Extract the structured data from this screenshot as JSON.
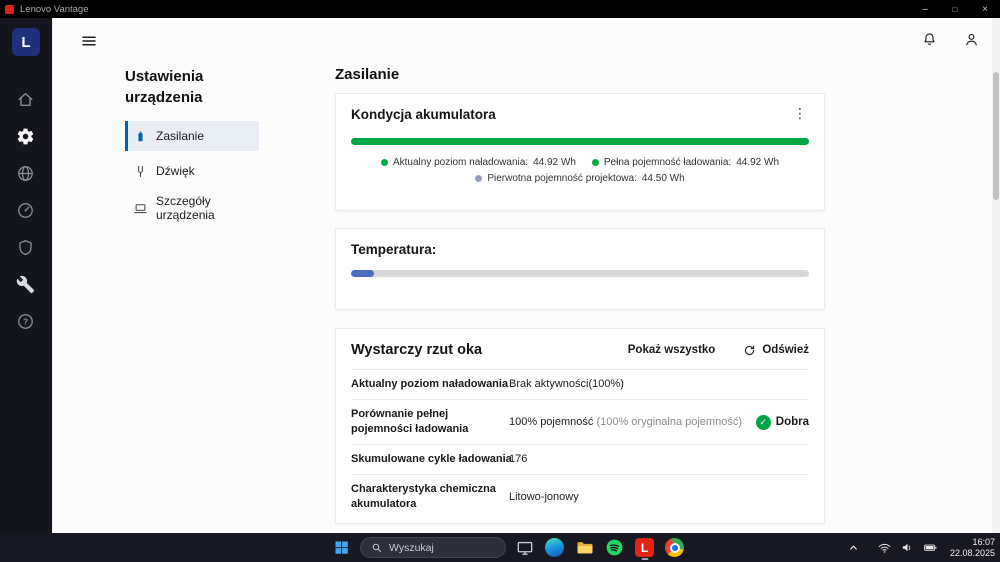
{
  "titlebar": {
    "title": "Lenovo Vantage",
    "minimize_glyph": "–",
    "maximize_glyph": "□",
    "close_glyph": "×"
  },
  "colors": {
    "accent": "#0063b1"
  },
  "sidebar": {
    "logo_letter": "L",
    "items": [
      {
        "icon": "home-icon",
        "active": false
      },
      {
        "icon": "settings-gear-icon",
        "active": true
      },
      {
        "icon": "browser-globe-icon",
        "active": false
      },
      {
        "icon": "performance-gauge-icon",
        "active": false
      },
      {
        "icon": "security-shield-icon",
        "active": false
      },
      {
        "icon": "hardware-tools-icon",
        "active": false
      },
      {
        "icon": "support-help-icon",
        "active": false
      }
    ]
  },
  "topbar": {
    "icons": [
      "notifications-bell-icon",
      "user-account-icon"
    ]
  },
  "subnav": {
    "title": "Ustawienia urządzenia",
    "items": [
      {
        "label": "Zasilanie",
        "icon": "battery-icon",
        "active": true
      },
      {
        "label": "Dźwięk",
        "icon": "sound-tuning-fork-icon",
        "active": false
      },
      {
        "label": "Szczegóły urządzenia",
        "icon": "laptop-icon",
        "active": false
      }
    ]
  },
  "main": {
    "page_title": "Zasilanie",
    "battery_card": {
      "title": "Kondycja akumulatora",
      "menu_glyph": "⋮",
      "bar_percent": 100,
      "bar_color": "#00a843",
      "legend": [
        {
          "label": "Aktualny poziom naładowania:",
          "value": "44.92 Wh",
          "color": "#00a843"
        },
        {
          "label": "Pełna pojemność ładowania:",
          "value": "44.92 Wh",
          "color": "#00c select"
        },
        {
          "label": "Pierwotna pojemność projektowa:",
          "value": "44.50 Wh",
          "color": "#94a0b8"
        }
      ]
    },
    "temperature_card": {
      "title": "Temperatura:",
      "bar_percent": 5,
      "bar_color": "#4a6cc3",
      "track_color": "#d8d8d8"
    },
    "glance_card": {
      "title": "Wystarczy rzut oka",
      "show_all_label": "Pokaż wszystko",
      "refresh_label": "Odśwież",
      "rows": [
        {
          "label": "Aktualny poziom naładowania",
          "value": "Brak aktywności(100%)"
        },
        {
          "label": "Porównanie pełnej pojemności ładowania",
          "value": "100% pojemność ",
          "value_muted": "(100% oryginalna pojemność)",
          "badge": "Dobra",
          "badge_check": "✓",
          "badge_color": "#00a344"
        },
        {
          "label": "Skumulowane cykle ładowania",
          "value": "176"
        },
        {
          "label": "Charakterystyka chemiczna akumulatora",
          "value": "Litowo-jonowy"
        }
      ]
    }
  },
  "taskbar": {
    "search_placeholder": "Wyszukaj",
    "apps": [
      "windows-start-icon",
      "monitor-icon",
      "edge-icon",
      "folder-icon",
      "spotify-icon",
      "lenovo-vantage-icon",
      "chrome-icon"
    ],
    "tray_icons": [
      "chevron-up-icon",
      "wifi-icon",
      "volume-icon",
      "battery-tray-icon"
    ],
    "clock": {
      "time": "16:07",
      "date": "22.08.2025"
    }
  }
}
